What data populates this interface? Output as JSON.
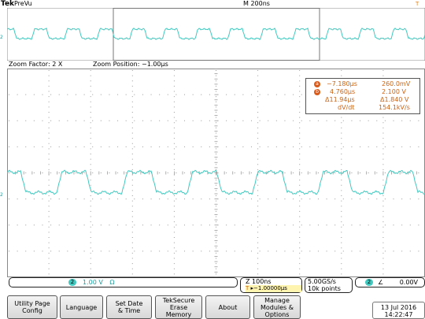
{
  "top": {
    "brand": "Tek",
    "mode": "PreVu",
    "timebase": "M 200ns",
    "trigger_marker": "T"
  },
  "zoom": {
    "factor": "Zoom Factor: 2 X",
    "position": "Zoom Position: −1.00µs"
  },
  "cursors": {
    "a_label": "a",
    "b_label": "b",
    "a_time": "−7.180µs",
    "a_value": "260.0mV",
    "b_time": "4.760µs",
    "b_value": "2.100 V",
    "delta_time": "Δ11.94µs",
    "delta_value": "Δ1.840 V",
    "dvdt_label": "dV/dt",
    "dvdt_value": "154.1kV/s"
  },
  "status": {
    "ch2_badge": "2",
    "ch2_scale": "1.00 V",
    "ch2_coupling": "Ω",
    "zoom_timebase": "Z 100ns",
    "trigger_pos_badge": "T",
    "trigger_pos": "▸−1.00000µs",
    "sample_rate": "5.00GS/s",
    "record_length": "10k points",
    "trig_source_badge": "2",
    "trig_slope": "∠",
    "trig_level": "0.00V"
  },
  "menu": [
    "Utility Page\nConfig",
    "Language",
    "Set Date\n& Time",
    "TekSecure\nErase\nMemory",
    "About",
    "Manage\nModules &\nOptions"
  ],
  "clock": "13 Jul  2016\n14:22:47",
  "colors": {
    "trace": "#41c9c0",
    "cursor": "#d85a1a",
    "grid": "#9a9a9a"
  },
  "channel_marker": "2"
}
